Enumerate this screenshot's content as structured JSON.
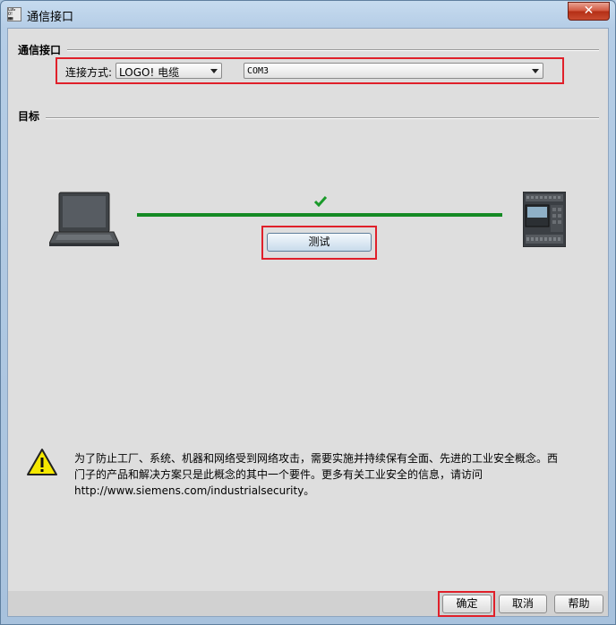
{
  "window": {
    "title": "通信接口",
    "close_glyph": "✕"
  },
  "section_interface": {
    "title": "通信接口",
    "connection_label": "连接方式:",
    "connection_value": "LOGO! 电缆",
    "port_value": "COM3"
  },
  "section_target": {
    "title": "目标",
    "test_button": "测试",
    "link_status": "connected",
    "link_color": "#158a24",
    "check_color": "#1a9a2a"
  },
  "warning": {
    "text": "为了防止工厂、系统、机器和网络受到网络攻击，需要实施并持续保有全面、先进的工业安全概念。西门子的产品和解决方案只是此概念的其中一个要件。更多有关工业安全的信息，请访问 http://www.siemens.com/industrialsecurity。"
  },
  "buttons": {
    "ok": "确定",
    "cancel": "取消",
    "help": "帮助"
  },
  "icons": {
    "app": "logo-soft-comfort-icon",
    "laptop": "laptop-icon",
    "plc": "logo-plc-icon",
    "check": "checkmark-icon",
    "warning": "warning-icon"
  }
}
